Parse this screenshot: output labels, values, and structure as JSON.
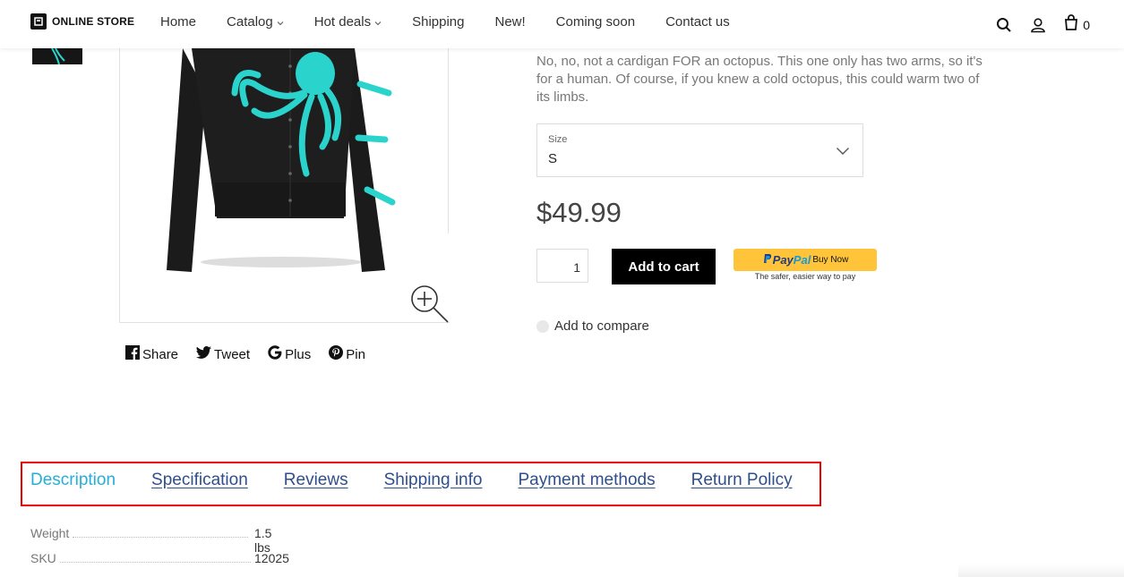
{
  "header": {
    "logo_text": "ONLINE STORE",
    "nav": [
      {
        "label": "Home",
        "dropdown": false
      },
      {
        "label": "Catalog",
        "dropdown": true
      },
      {
        "label": "Hot deals",
        "dropdown": true
      },
      {
        "label": "Shipping",
        "dropdown": false
      },
      {
        "label": "New!",
        "dropdown": false
      },
      {
        "label": "Coming soon",
        "dropdown": false
      },
      {
        "label": "Contact us",
        "dropdown": false
      }
    ],
    "cart_count": "0",
    "icons": [
      "search-icon",
      "account-icon",
      "cart-icon"
    ]
  },
  "product": {
    "description": "No, no, not a cardigan FOR an octopus. This one only has two arms, so it's for a human. Of course, if you knew a cold octopus, this could warm two of its limbs.",
    "size": {
      "label": "Size",
      "value": "S"
    },
    "price": "$49.99",
    "quantity": "1",
    "add_to_cart": "Add to cart",
    "paypal": {
      "brand_pay": "Pay",
      "brand_pal": "Pal",
      "button_text": "Buy Now",
      "tagline": "The safer, easier way to pay"
    },
    "compare": "Add to compare"
  },
  "share": [
    {
      "label": "Share",
      "icon": "facebook-icon"
    },
    {
      "label": "Tweet",
      "icon": "twitter-icon"
    },
    {
      "label": "Plus",
      "icon": "google-icon"
    },
    {
      "label": "Pin",
      "icon": "pinterest-icon"
    }
  ],
  "tabs": [
    {
      "label": "Description",
      "active": true
    },
    {
      "label": "Specification",
      "active": false
    },
    {
      "label": "Reviews",
      "active": false
    },
    {
      "label": "Shipping info",
      "active": false
    },
    {
      "label": "Payment methods",
      "active": false
    },
    {
      "label": "Return Policy",
      "active": false
    }
  ],
  "specs": [
    {
      "name": "Weight",
      "value": "1.5 lbs"
    },
    {
      "name": "SKU",
      "value": "12025"
    }
  ],
  "colors": {
    "accent": "#27aed6",
    "tab_link": "#2f4f8a",
    "highlight_border": "#e00000",
    "paypal": "#ffc439",
    "octopus": "#2ad4cc"
  }
}
